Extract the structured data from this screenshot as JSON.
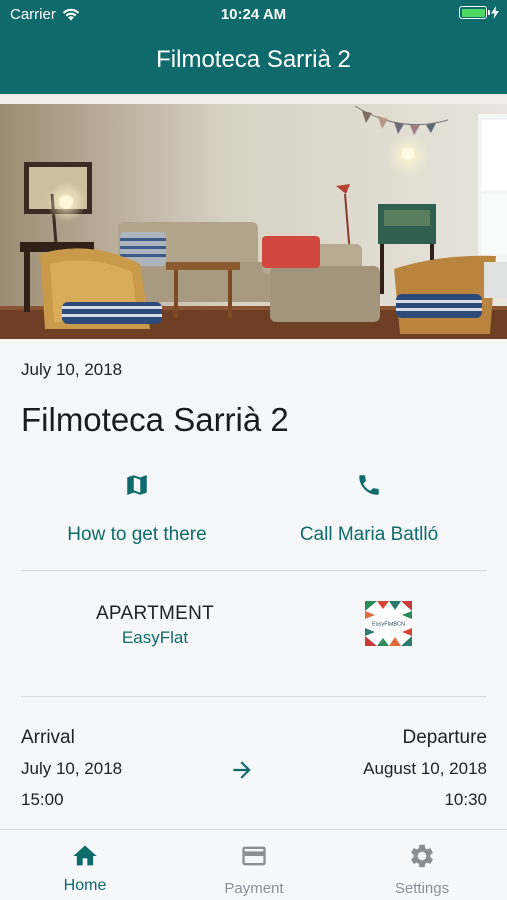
{
  "status_bar": {
    "carrier": "Carrier",
    "time": "10:24 AM"
  },
  "nav": {
    "title": "Filmoteca Sarrià 2"
  },
  "booking": {
    "date": "July 10, 2018",
    "title": "Filmoteca Sarrià 2",
    "directions_label": "How to get there",
    "call_label": "Call Maria Batlló",
    "accommodation_type": "APARTMENT",
    "provider_name": "EasyFlat",
    "provider_logo_text": "EasyFlatBCN",
    "arrival_label": "Arrival",
    "arrival_date": "July 10, 2018",
    "arrival_time": "15:00",
    "departure_label": "Departure",
    "departure_date": "August 10, 2018",
    "departure_time": "10:30"
  },
  "tabs": [
    {
      "label": "Home",
      "icon": "home-icon",
      "active": true
    },
    {
      "label": "Payment",
      "icon": "credit-card-icon",
      "active": false
    },
    {
      "label": "Settings",
      "icon": "gear-icon",
      "active": false
    }
  ],
  "colors": {
    "brand": "#0f6b6b",
    "inactive": "#8a8f94",
    "battery": "#4cd964"
  }
}
